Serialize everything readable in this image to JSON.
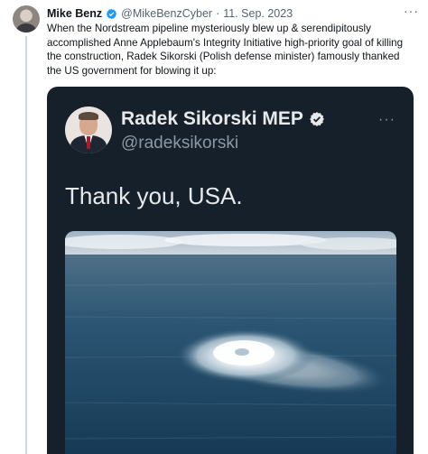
{
  "tweet": {
    "author_name": "Mike Benz",
    "handle": "@MikeBenzCyber",
    "separator": "·",
    "date": "11. Sep. 2023",
    "more_label": "···",
    "text": "When the Nordstream pipeline mysteriously blew up & serendipitously accomplished Anne Applebaum's Integrity Initiative high-priority goal of killing the construction, Radek Sikorski (Polish defense minister) famously thanked the US government for blowing it up:"
  },
  "quoted": {
    "author_name": "Radek Sikorski MEP",
    "handle": "@radeksikorski",
    "more_label": "···",
    "text": "Thank you, USA."
  },
  "colors": {
    "verified_blue": "#1d9bf0",
    "quote_background": "#15202b",
    "sea": "#1f4c6b"
  },
  "icons": {
    "verified": "verified-badge-icon",
    "more": "more-dots-icon"
  }
}
